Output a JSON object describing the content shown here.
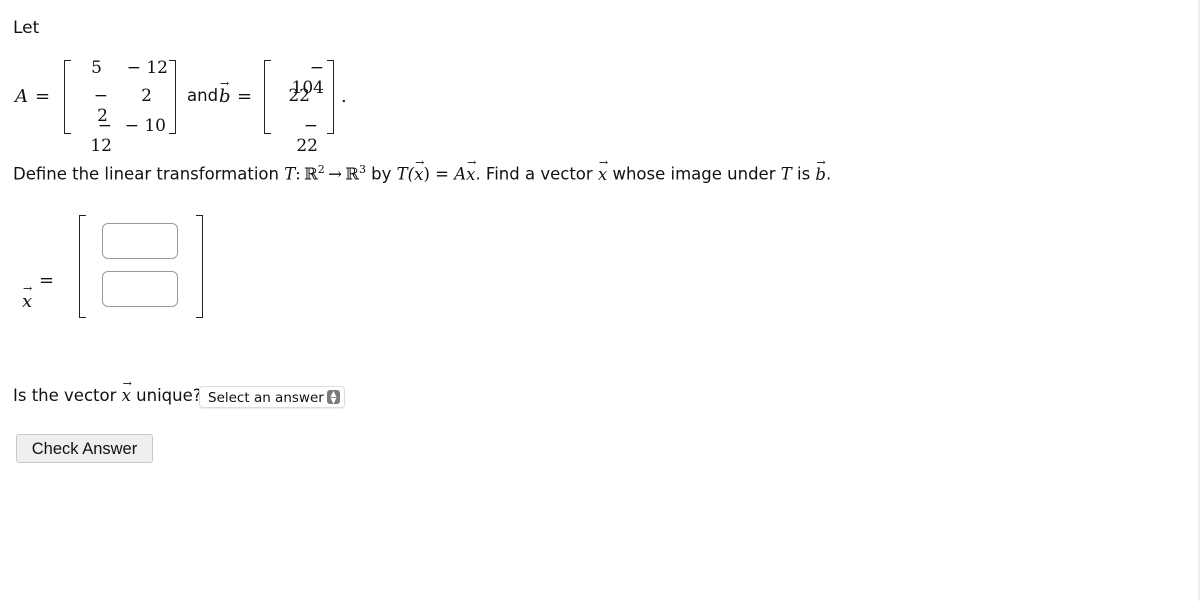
{
  "intro": "Let",
  "matrix_A": {
    "label": "A",
    "rows": [
      [
        "5",
        "− 12"
      ],
      [
        "− 2",
        "2"
      ],
      [
        "− 12",
        "− 10"
      ]
    ]
  },
  "and_text": "and",
  "vector_b": {
    "label": "b",
    "rows": [
      "− 104",
      "22",
      "− 22"
    ]
  },
  "equals": "=",
  "period": ".",
  "question": {
    "part1": "Define the linear transformation ",
    "T": "T",
    "colon": ":",
    "R": "ℝ",
    "sup2": "2",
    "arrow": "→",
    "sup3": "3",
    "by": " by ",
    "Tx_open": "T(",
    "x": "x",
    "close": ")",
    "eq": " = ",
    "A": "A",
    "part2": ". Find a vector ",
    "part3": " whose image under ",
    "part4": " is ",
    "b": "b",
    "end": "."
  },
  "answer_vector": {
    "label": "x",
    "inputs": [
      {
        "value": "",
        "placeholder": ""
      },
      {
        "value": "",
        "placeholder": ""
      }
    ]
  },
  "unique_question": {
    "prefix": "Is the vector ",
    "x": "x",
    "suffix": " unique?",
    "select_value": "Select an answer",
    "arrows_icon": "⌃⌄"
  },
  "check_button": "Check Answer"
}
